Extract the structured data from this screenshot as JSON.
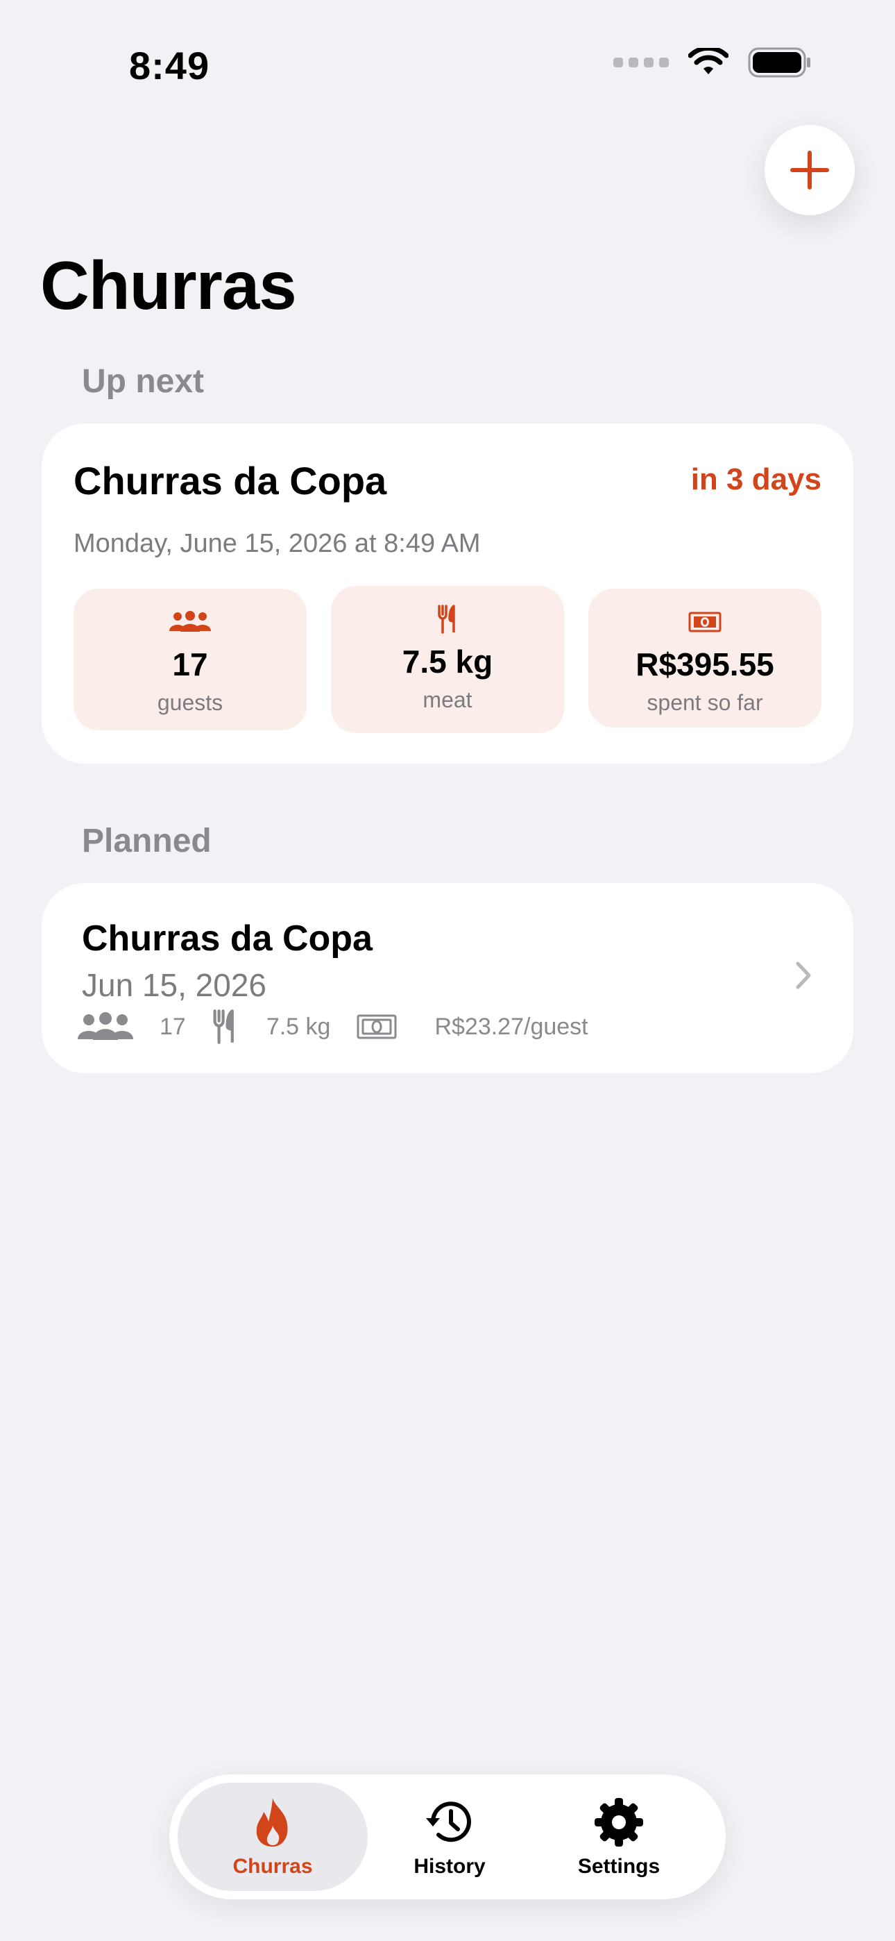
{
  "status_bar": {
    "time": "8:49"
  },
  "header": {
    "title": "Churras",
    "add_button": "plus-icon"
  },
  "up_next": {
    "section_label": "Up next",
    "title": "Churras da Copa",
    "countdown": "in 3 days",
    "date": "Monday, June 15, 2026 at 8:49 AM",
    "stats": [
      {
        "icon": "people-icon",
        "value": "17",
        "label": "guests"
      },
      {
        "icon": "fork-knife-icon",
        "value": "7.5 kg",
        "label": "meat"
      },
      {
        "icon": "money-icon",
        "value": "R$395.55",
        "label": "spent so far"
      }
    ]
  },
  "planned": {
    "section_label": "Planned",
    "items": [
      {
        "title": "Churras da Copa",
        "date": "Jun 15, 2026",
        "guests": "17",
        "meat": "7.5 kg",
        "cost": "R$23.27/guest"
      }
    ]
  },
  "tabbar": {
    "tabs": [
      {
        "label": "Churras",
        "icon": "flame-icon",
        "active": true
      },
      {
        "label": "History",
        "icon": "clock-history-icon",
        "active": false
      },
      {
        "label": "Settings",
        "icon": "gear-icon",
        "active": false
      }
    ]
  },
  "colors": {
    "accent": "#d2441a",
    "background": "#f2f1f6",
    "stat_bg": "#fbeeea",
    "secondary_text": "#7c7c80"
  }
}
